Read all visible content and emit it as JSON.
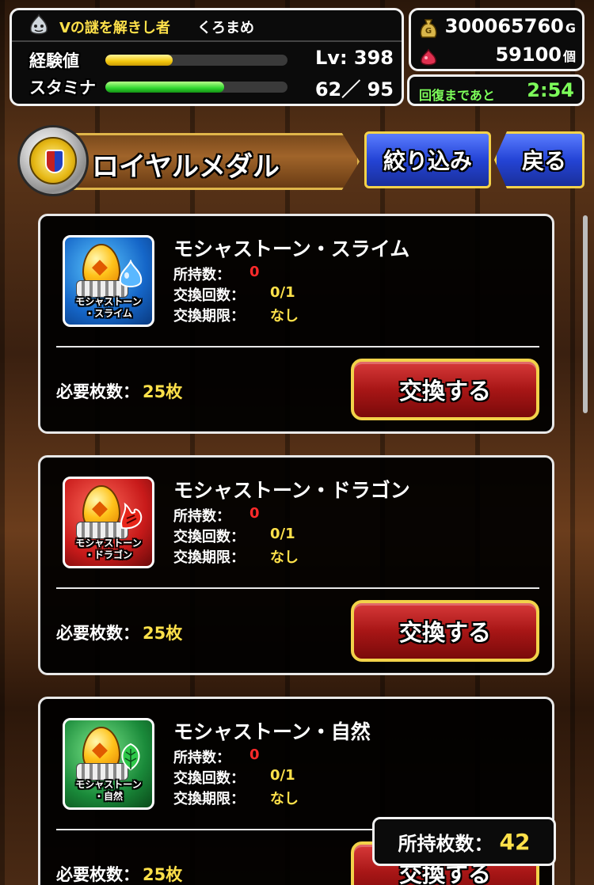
{
  "header": {
    "title": "Vの謎を解きし者",
    "player_name": "くろまめ",
    "exp_label": "経験値",
    "level": "Lv: 398",
    "exp_progress": 0.37,
    "stamina_label": "スタミナ",
    "stamina_value": "62／ 95",
    "stamina_progress": 0.65,
    "gold_icon": "money-bag-icon",
    "gold_value": "300065760",
    "gold_unit": "G",
    "gem_icon": "red-gem-icon",
    "gem_value": "59100",
    "gem_unit": "個",
    "recover_label": "回復まであと",
    "recover_time": "2:54"
  },
  "titlebar": {
    "title": "ロイヤルメダル",
    "filter_label": "絞り込み",
    "back_label": "戻る",
    "medal_icon": "royal-medal-icon"
  },
  "items": [
    {
      "name": "モシャストーン・スライム",
      "icon_caption_1": "モシャストーン",
      "icon_caption_2": "・スライム",
      "icon_element": "slime-drop-icon",
      "owned_label": "所持数：",
      "owned_value": "0",
      "count_label": "交換回数：",
      "count_value": "0/1",
      "limit_label": "交換期限：",
      "limit_value": "なし",
      "cost_label": "必要枚数：",
      "cost_value": "25枚",
      "button_label": "交換する"
    },
    {
      "name": "モシャストーン・ドラゴン",
      "icon_caption_1": "モシャストーン",
      "icon_caption_2": "・ドラゴン",
      "icon_element": "dragon-flame-icon",
      "owned_label": "所持数：",
      "owned_value": "0",
      "count_label": "交換回数：",
      "count_value": "0/1",
      "limit_label": "交換期限：",
      "limit_value": "なし",
      "cost_label": "必要枚数：",
      "cost_value": "25枚",
      "button_label": "交換する"
    },
    {
      "name": "モシャストーン・自然",
      "icon_caption_1": "モシャストーン",
      "icon_caption_2": "・自然",
      "icon_element": "leaf-icon",
      "owned_label": "所持数：",
      "owned_value": "0",
      "count_label": "交換回数：",
      "count_value": "0/1",
      "limit_label": "交換期限：",
      "limit_value": "なし",
      "cost_label": "必要枚数：",
      "cost_value": "25枚",
      "button_label": "交換する"
    }
  ],
  "footer": {
    "owned_label": "所持枚数：",
    "owned_value": "42"
  },
  "colors": {
    "accent_yellow": "#ffe14a",
    "accent_green": "#7dff5a",
    "alert_red": "#ff2a2a",
    "button_blue": "#2444d6",
    "button_red": "#a81616"
  }
}
